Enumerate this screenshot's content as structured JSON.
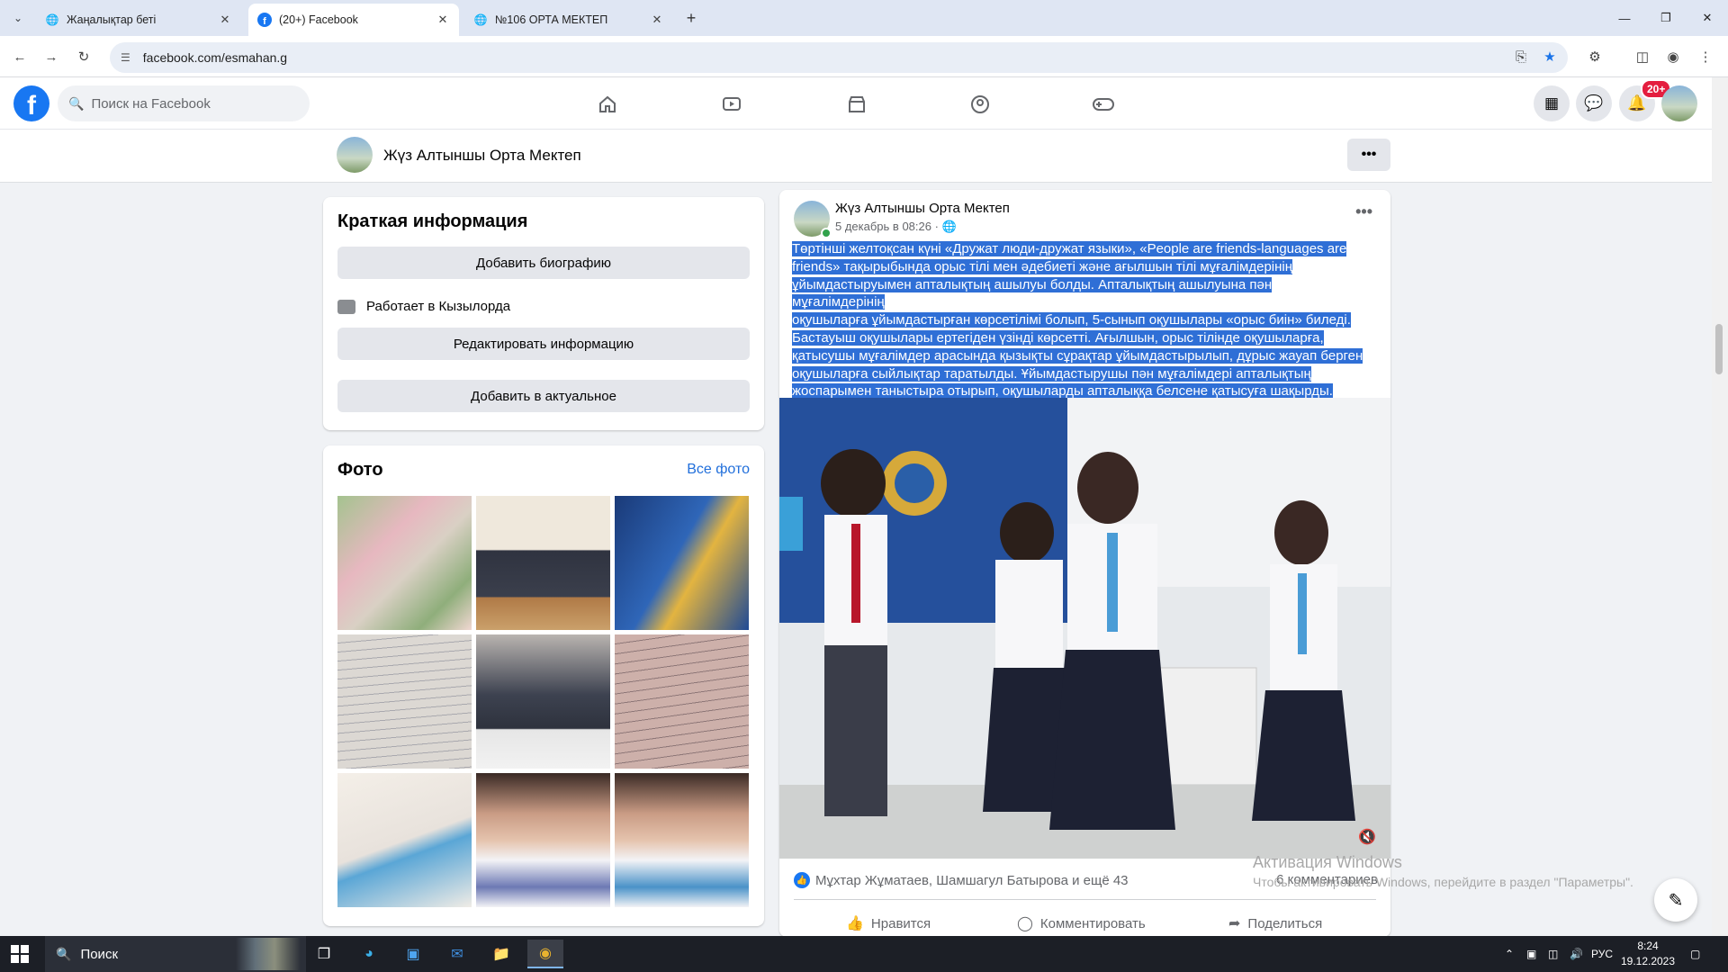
{
  "browser": {
    "tabs": [
      {
        "title": "Жаңалықтар беті",
        "active": false
      },
      {
        "title": "(20+) Facebook",
        "active": true
      },
      {
        "title": "№106 ОРТА МЕКТЕП",
        "active": false
      }
    ],
    "url": "facebook.com/esmahan.g"
  },
  "fb_header": {
    "search_placeholder": "Поиск на Facebook",
    "notification_badge": "20+"
  },
  "page_bar": {
    "name": "Жүз Алтыншы Орта Мектеп"
  },
  "intro": {
    "title": "Краткая информация",
    "add_bio": "Добавить биографию",
    "work": "Работает в Кызылорда",
    "edit_info": "Редактировать информацию",
    "add_featured": "Добавить в актуальное"
  },
  "photos": {
    "title": "Фото",
    "all_link": "Все фото"
  },
  "post": {
    "author": "Жүз Алтыншы Орта Мектеп",
    "date": "5 декабрь в 08:26 ·",
    "lines": [
      "Төртінші желтоқсан күні «Дружат люди-дружат языки», «People are friends-languages are",
      "friends» тақырыбында  орыс тілі мен әдебиеті және ағылшын тілі мұғалімдерінің",
      "ұйымдастыруымен апталықтың ашылуы болды. Апталықтың ашылуына пән мұғалімдерінің",
      "оқушыларға ұйымдастырған көрсетілімі болып, 5-сынып оқушылары «орыс биін» биледі.",
      "Бастауыш оқушылары ертегіден үзінді көрсетті. Ағылшын, орыс тілінде оқушыларға,",
      "қатысушы мұғалімдер арасында қызықты сұрақтар ұйымдастырылып, дұрыс жауап берген",
      "оқушыларға сыйлықтар таратылды. Ұйымдастырушы пән мұғалімдері апталықтың",
      "жоспарымен таныстыра отырып, оқушыларды апталыққа белсене қатысуға шақырды."
    ],
    "reactions": "Мұхтар Жұматаев, Шамшагул Батырова и ещё 43",
    "comments": "6 комментариев",
    "actions": {
      "like": "Нравится",
      "comment": "Комментировать",
      "share": "Поделиться"
    }
  },
  "windows": {
    "activation_title": "Активация Windows",
    "activation_text": "Чтобы активировать Windows, перейдите в раздел \"Параметры\".",
    "search_label": "Поиск",
    "language": "РУС",
    "time": "8:24",
    "date": "19.12.2023"
  }
}
